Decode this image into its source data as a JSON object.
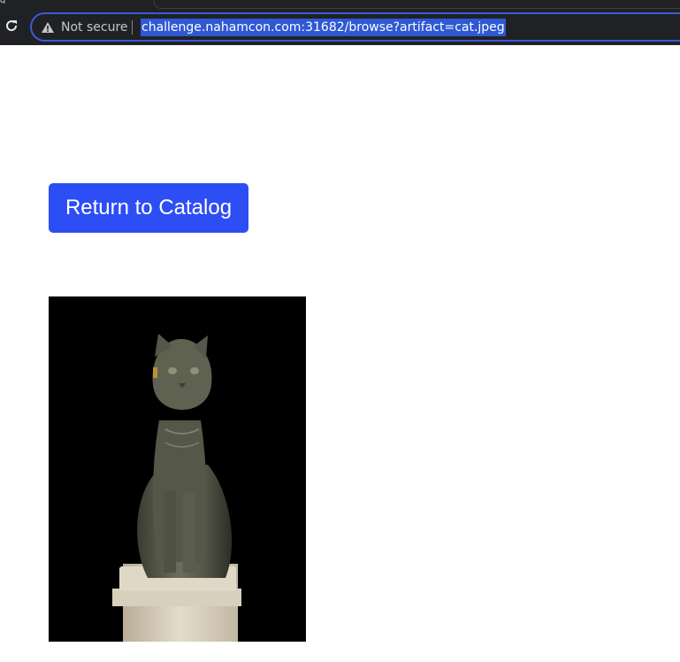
{
  "browser": {
    "tab_fragment": "g",
    "security_label": "Not secure",
    "url": "challenge.nahamcon.com:31682/browse?artifact=cat.jpeg",
    "icons": {
      "reload": "reload-icon",
      "warning": "warning-triangle-icon"
    }
  },
  "page": {
    "return_button_label": "Return to Catalog",
    "artifact_image_alt": "cat.jpeg",
    "colors": {
      "button": "#2d4ef5",
      "image_background": "#000000"
    }
  }
}
